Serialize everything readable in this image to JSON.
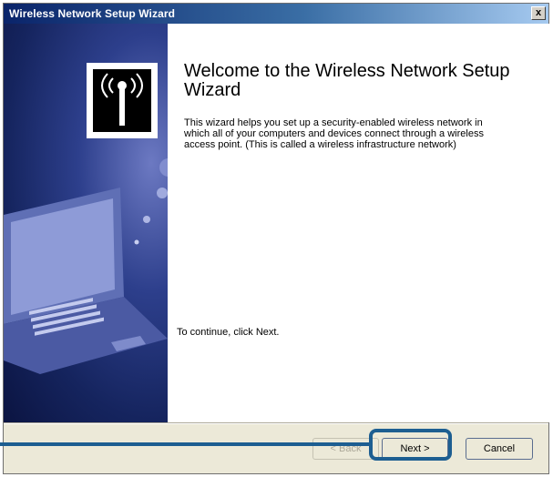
{
  "window": {
    "title": "Wireless Network Setup Wizard",
    "close_label": "x"
  },
  "content": {
    "heading": "Welcome to the Wireless Network Setup Wizard",
    "description": "This wizard helps you set up a security-enabled wireless network in which all of your computers and devices connect through a wireless access point. (This is called a wireless infrastructure network)",
    "continue_text": "To continue, click Next."
  },
  "buttons": {
    "back": "< Back",
    "next": "Next >",
    "cancel": "Cancel"
  },
  "colors": {
    "title_bar": "#0a246a",
    "panel": "#1e2b6e",
    "callout": "#1d5e91"
  },
  "icons": {
    "wizard": "wireless-antenna-icon",
    "illustration": "laptop-illustration"
  }
}
